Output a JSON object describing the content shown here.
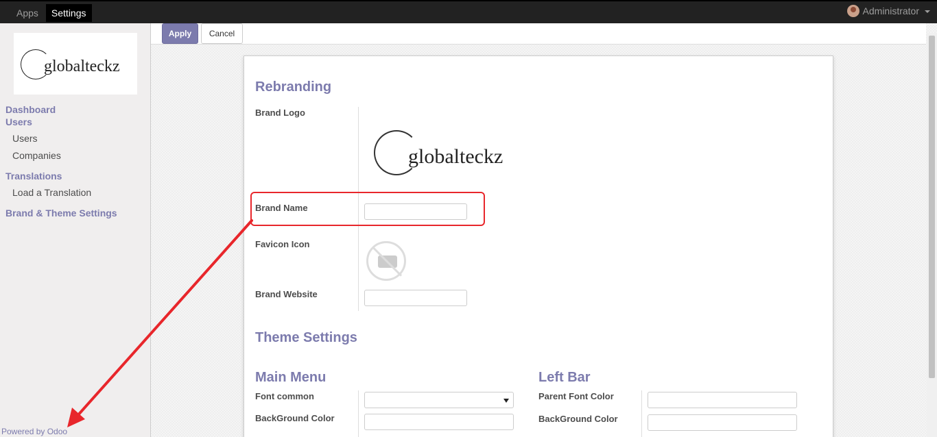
{
  "topbar": {
    "menu": [
      {
        "label": "Apps",
        "active": false
      },
      {
        "label": "Settings",
        "active": true
      }
    ],
    "user": "Administrator"
  },
  "sidebar": {
    "logo_text": "globalteckz",
    "nav": {
      "dashboard": "Dashboard",
      "users_section": "Users",
      "users": "Users",
      "companies": "Companies",
      "translations_section": "Translations",
      "load_translation": "Load a Translation",
      "brand_theme": "Brand & Theme Settings"
    },
    "footer": {
      "powered": "Powered by",
      "odoo": "Odoo"
    }
  },
  "toolbar": {
    "apply_label": "Apply",
    "cancel_label": "Cancel"
  },
  "form": {
    "rebranding": {
      "title": "Rebranding",
      "brand_logo_label": "Brand Logo",
      "brand_logo_text": "globalteckz",
      "brand_name_label": "Brand Name",
      "brand_name_value": "",
      "favicon_label": "Favicon Icon",
      "brand_website_label": "Brand Website",
      "brand_website_value": ""
    },
    "theme": {
      "title": "Theme Settings",
      "main_menu": {
        "title": "Main Menu",
        "font_common_label": "Font common",
        "font_common_value": "",
        "background_label": "BackGround Color"
      },
      "left_bar": {
        "title": "Left Bar",
        "parent_font_label": "Parent Font Color",
        "background_label": "BackGround Color"
      }
    }
  },
  "colors": {
    "accent": "#7c7bad",
    "topbar": "#222222",
    "annotation": "#e8262b"
  }
}
